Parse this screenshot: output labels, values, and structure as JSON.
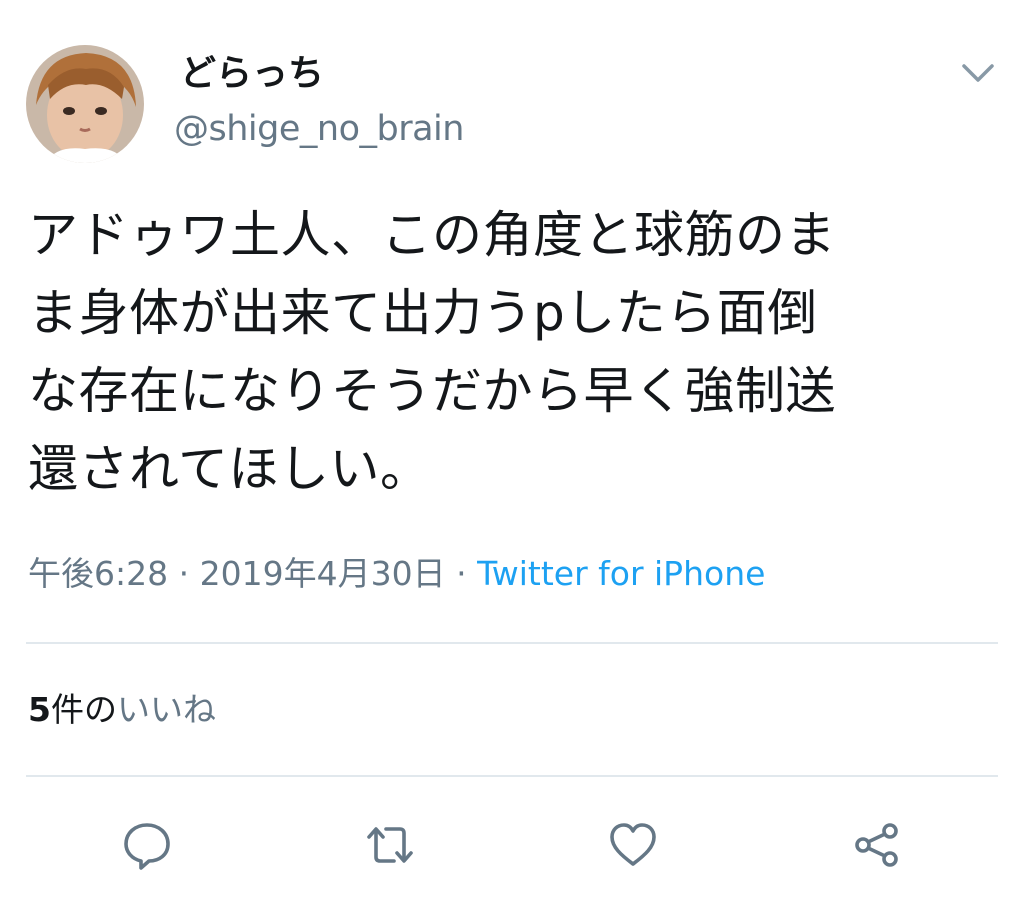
{
  "user": {
    "display_name": "どらっち",
    "handle": "@shige_no_brain"
  },
  "tweet": {
    "text": "アドゥワ土人、この角度と球筋のま\nま身体が出来て出力うpしたら面倒\nな存在になりそうだから早く強制送\n還されてほしい。",
    "time": "午後6:28",
    "separator": " · ",
    "date": "2019年4月30日",
    "source": "Twitter for iPhone"
  },
  "stats": {
    "likes_count": "5",
    "likes_unit": "件の",
    "likes_label": "いいね"
  },
  "icons": {
    "menu": "chevron-down-icon",
    "reply": "reply-icon",
    "retweet": "retweet-icon",
    "like": "heart-icon",
    "share": "share-icon"
  },
  "colors": {
    "text_primary": "#14171a",
    "text_secondary": "#657786",
    "link": "#1da1f2",
    "divider": "#e1e8ed",
    "icon": "#657786"
  }
}
